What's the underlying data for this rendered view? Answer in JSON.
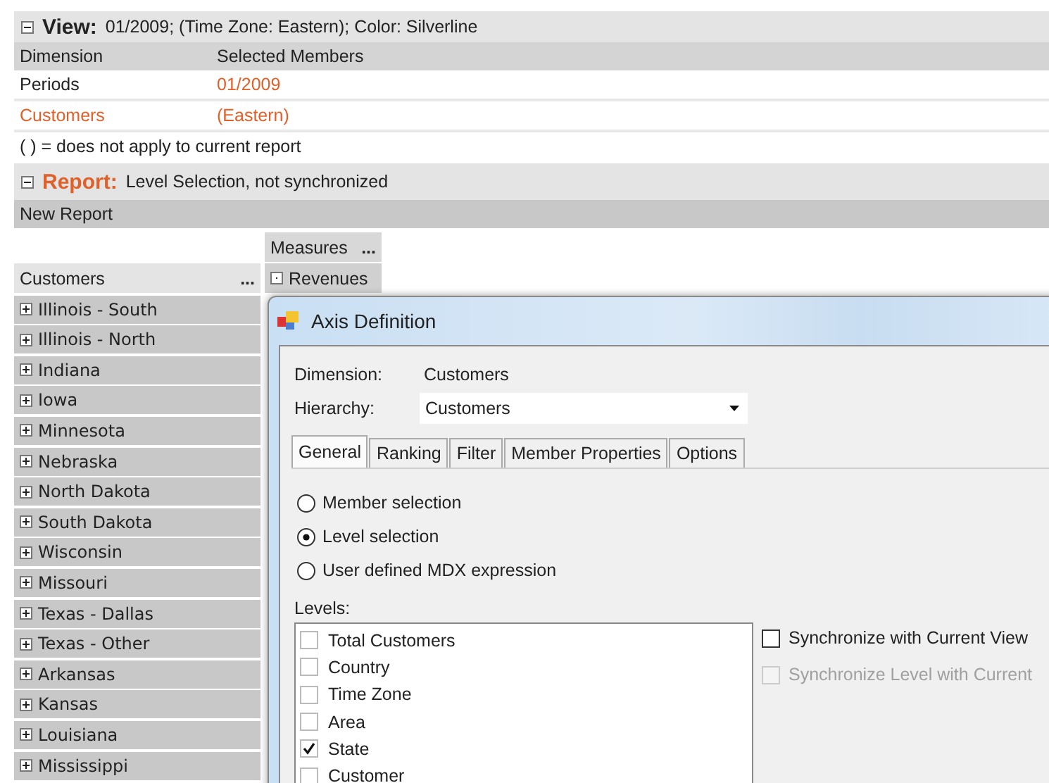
{
  "view": {
    "expanded": true,
    "label": "View:",
    "title": "01/2009; (Time Zone: Eastern); Color: Silverline",
    "columns": [
      "Dimension",
      "Selected Members"
    ],
    "rows": [
      {
        "dimension": "Periods",
        "members": "01/2009",
        "highlighted": false
      },
      {
        "dimension": "Customers",
        "members": "(Eastern)",
        "highlighted": true
      }
    ],
    "note": "( ) = does not apply to current report"
  },
  "report": {
    "expanded": true,
    "label": "Report:",
    "title": "Level Selection, not synchronized",
    "name": "New Report"
  },
  "pivot": {
    "columns_header": "Measures",
    "columns_more": "...",
    "rows_header": "Customers",
    "rows_more": "...",
    "measures": [
      {
        "label": "Revenues"
      }
    ],
    "rows": [
      {
        "label": "Illinois - South",
        "expanded": false
      },
      {
        "label": "Illinois - North",
        "expanded": false
      },
      {
        "label": "Indiana",
        "expanded": false
      },
      {
        "label": "Iowa",
        "expanded": false
      },
      {
        "label": "Minnesota",
        "expanded": false
      },
      {
        "label": "Nebraska",
        "expanded": false
      },
      {
        "label": "North Dakota",
        "expanded": false
      },
      {
        "label": "South Dakota",
        "expanded": false
      },
      {
        "label": "Wisconsin",
        "expanded": false
      },
      {
        "label": "Missouri",
        "expanded": false
      },
      {
        "label": "Texas - Dallas",
        "expanded": false
      },
      {
        "label": "Texas - Other",
        "expanded": false
      },
      {
        "label": "Arkansas",
        "expanded": false
      },
      {
        "label": "Kansas",
        "expanded": false
      },
      {
        "label": "Louisiana",
        "expanded": false
      },
      {
        "label": "Mississippi",
        "expanded": false
      }
    ]
  },
  "dialog": {
    "title": "Axis Definition",
    "dimension_label": "Dimension:",
    "dimension_value": "Customers",
    "hierarchy_label": "Hierarchy:",
    "hierarchy_value": "Customers",
    "tabs": [
      {
        "label": "General",
        "selected": true
      },
      {
        "label": "Ranking",
        "selected": false
      },
      {
        "label": "Filter",
        "selected": false
      },
      {
        "label": "Member Properties",
        "selected": false
      },
      {
        "label": "Options",
        "selected": false
      }
    ],
    "options": [
      {
        "label": "Member selection",
        "selected": false
      },
      {
        "label": "Level selection",
        "selected": true
      },
      {
        "label": "User defined MDX expression",
        "selected": false
      }
    ],
    "levels_label": "Levels:",
    "levels": [
      {
        "label": "Total Customers",
        "checked": false
      },
      {
        "label": "Country",
        "checked": false
      },
      {
        "label": "Time Zone",
        "checked": false
      },
      {
        "label": "Area",
        "checked": false
      },
      {
        "label": "State",
        "checked": true
      },
      {
        "label": "Customer",
        "checked": false
      }
    ],
    "sync_options": [
      {
        "label": "Synchronize with Current View",
        "checked": false,
        "disabled": false
      },
      {
        "label": "Synchronize Level with Current",
        "checked": false,
        "disabled": true
      }
    ]
  }
}
